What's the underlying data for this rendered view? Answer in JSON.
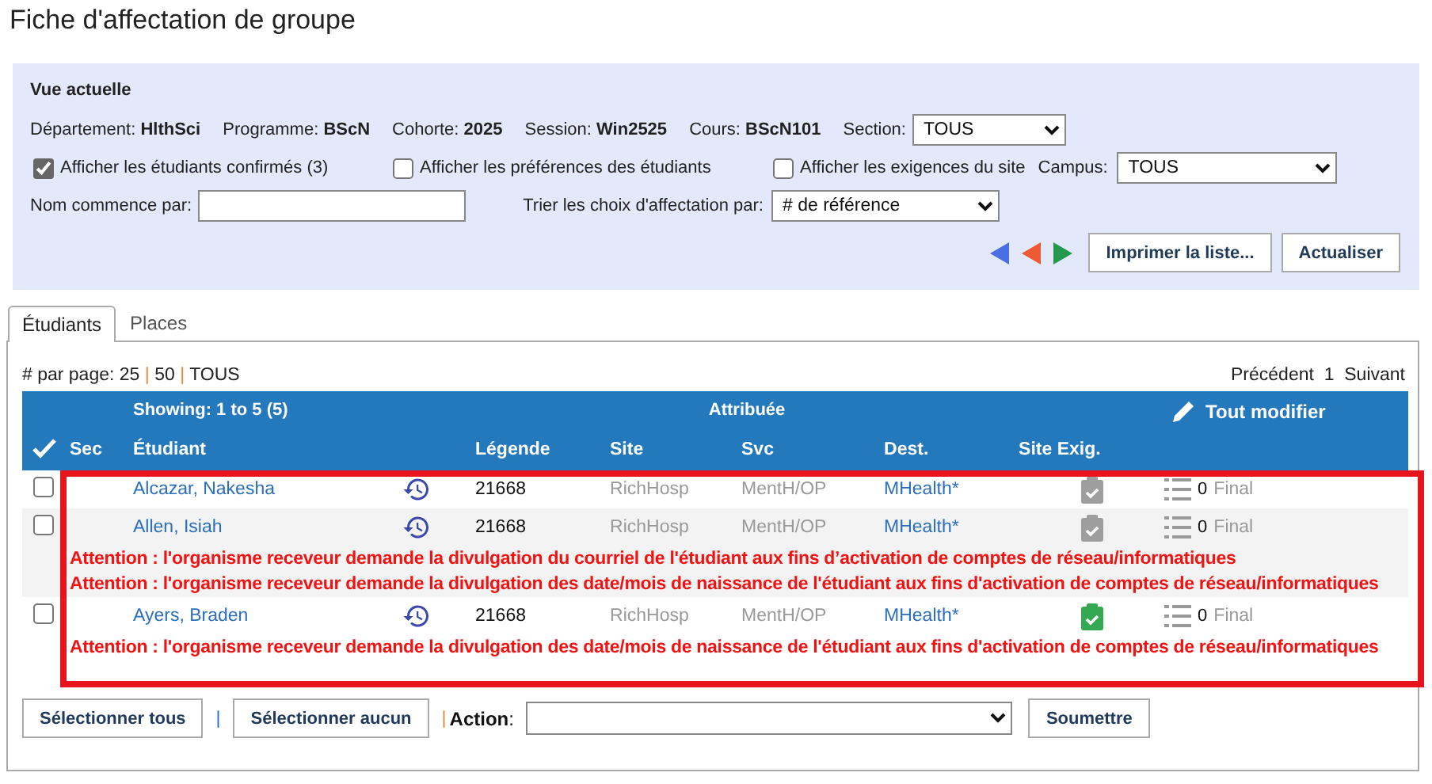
{
  "title": "Fiche d'affectation de groupe",
  "current_view": {
    "heading": "Vue actuelle",
    "facts": [
      {
        "label": "Département:",
        "value": "HlthSci"
      },
      {
        "label": "Programme:",
        "value": "BScN"
      },
      {
        "label": "Cohorte:",
        "value": "2025"
      },
      {
        "label": "Session:",
        "value": "Win2525"
      },
      {
        "label": "Cours:",
        "value": "BScN101"
      }
    ],
    "section": {
      "label": "Section:",
      "value": "TOUS"
    },
    "options": [
      {
        "label": "Afficher les étudiants confirmés (3)",
        "checked": true
      },
      {
        "label": "Afficher les préférences des étudiants",
        "checked": false
      },
      {
        "label": "Afficher les exigences du site",
        "checked": false
      }
    ],
    "campus": {
      "label": "Campus:",
      "value": "TOUS"
    },
    "name_filter": {
      "label": "Nom commence par:"
    },
    "sort": {
      "label": "Trier les choix d'affectation par:",
      "value": "# de référence"
    },
    "buttons": [
      "Imprimer la liste...",
      "Actualiser"
    ]
  },
  "tabs": [
    {
      "label": "Étudiants",
      "selected": true
    },
    {
      "label": "Places",
      "selected": false
    }
  ],
  "paging": {
    "label": "# par page:",
    "sizes": [
      "25",
      "50",
      "TOUS"
    ],
    "separator": "|",
    "previous": "Précédent",
    "current": "1",
    "next": "Suivant"
  },
  "table": {
    "showing": "Showing: 1 to 5 (5)",
    "group_heading": "Attribuée",
    "edit_all": "Tout modifier",
    "columns": [
      "Sec",
      "Étudiant",
      "Légende",
      "Site",
      "Svc",
      "Dest.",
      "Site Exig."
    ],
    "rows": [
      {
        "checked": false,
        "student": "Alcazar, Nakesha",
        "legend": "21668",
        "site": "RichHosp",
        "svc": "MentH/OP",
        "dest": "MHealth*",
        "requirements_met": false,
        "count": "0",
        "status": "Final"
      },
      {
        "checked": false,
        "student": "Allen, Isiah",
        "legend": "21668",
        "site": "RichHosp",
        "svc": "MentH/OP",
        "dest": "MHealth*",
        "requirements_met": false,
        "count": "0",
        "status": "Final",
        "warnings": [
          "Attention : l'organisme receveur demande la divulgation du courriel de l'étudiant aux fins d’activation de comptes de réseau/informatiques",
          "Attention : l'organisme receveur demande la divulgation des date/mois de naissance de l'étudiant aux fins d'activation de comptes de réseau/informatiques"
        ]
      },
      {
        "checked": false,
        "student": "Ayers, Braden",
        "legend": "21668",
        "site": "RichHosp",
        "svc": "MentH/OP",
        "dest": "MHealth*",
        "requirements_met": true,
        "count": "0",
        "status": "Final",
        "warnings": [
          "Attention : l'organisme receveur demande la divulgation des date/mois de naissance de l'étudiant aux fins d'activation de comptes de réseau/informatiques"
        ]
      }
    ]
  },
  "footer": {
    "select_all": "Sélectionner tous",
    "separators": [
      "|",
      "|"
    ],
    "select_none": "Sélectionner aucun",
    "action_label": "**Action**:",
    "submit": "Soumettre"
  }
}
